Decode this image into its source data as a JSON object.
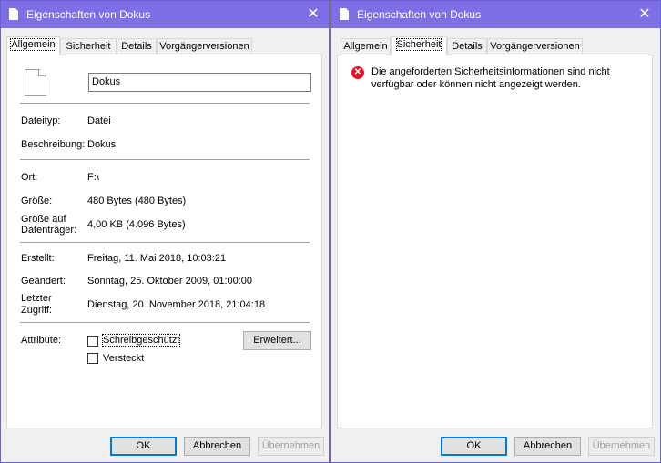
{
  "left": {
    "title": "Eigenschaften von Dokus",
    "tabs": [
      "Allgemein",
      "Sicherheit",
      "Details",
      "Vorgängerversionen"
    ],
    "name_value": "Dokus",
    "rows": {
      "dateityp_label": "Dateityp:",
      "dateityp_value": "Datei",
      "beschreibung_label": "Beschreibung:",
      "beschreibung_value": "Dokus",
      "ort_label": "Ort:",
      "ort_value": "F:\\",
      "groesse_label": "Größe:",
      "groesse_value": "480 Bytes (480 Bytes)",
      "groesse_dt_label_1": "Größe auf",
      "groesse_dt_label_2": "Datenträger:",
      "groesse_dt_value": "4,00 KB (4.096 Bytes)",
      "erstellt_label": "Erstellt:",
      "erstellt_value": "Freitag, 11. Mai 2018, 10:03:21",
      "geaendert_label": "Geändert:",
      "geaendert_value": "Sonntag, 25. Oktober 2009, 01:00:00",
      "zugriff_label_1": "Letzter",
      "zugriff_label_2": "Zugriff:",
      "zugriff_value": "Dienstag, 20. November 2018, 21:04:18",
      "attribute_label": "Attribute:"
    },
    "attributes": {
      "readonly_label": "Schreibgeschützt",
      "readonly_checked": false,
      "hidden_label": "Versteckt",
      "hidden_checked": false,
      "advanced_button": "Erweitert..."
    },
    "buttons": {
      "ok": "OK",
      "cancel": "Abbrechen",
      "apply": "Übernehmen"
    }
  },
  "right": {
    "title": "Eigenschaften von Dokus",
    "tabs": [
      "Allgemein",
      "Sicherheit",
      "Details",
      "Vorgängerversionen"
    ],
    "error_text": "Die angeforderten Sicherheitsinformationen sind nicht verfügbar oder können nicht angezeigt werden.",
    "buttons": {
      "ok": "OK",
      "cancel": "Abbrechen",
      "apply": "Übernehmen"
    }
  },
  "icons": {
    "title": "document-icon",
    "close": "close-icon",
    "file": "file-icon",
    "error": "error-icon"
  },
  "colors": {
    "titlebar": "#7d6fe5",
    "default_button_border": "#0078d7",
    "error": "#e81123"
  }
}
